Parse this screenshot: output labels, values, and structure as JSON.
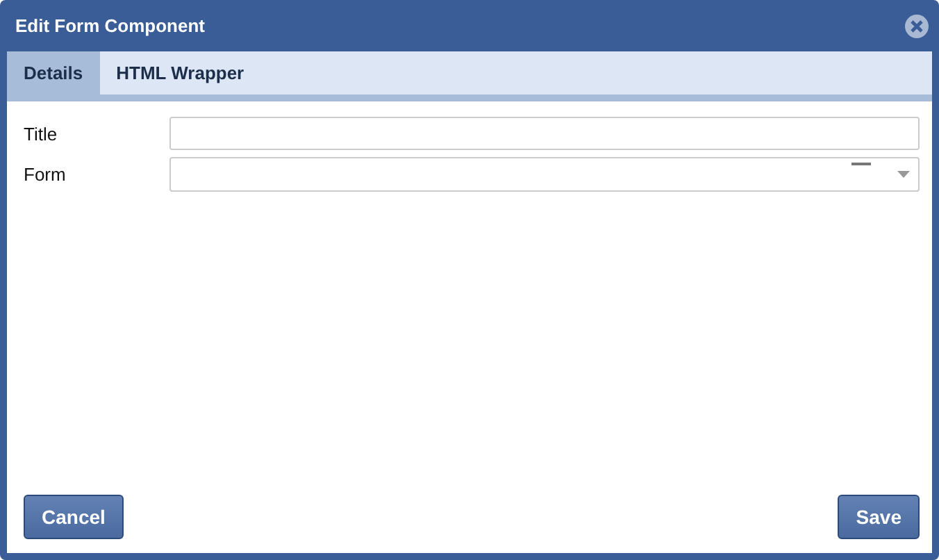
{
  "window": {
    "title": "Edit Form Component"
  },
  "tabs": [
    {
      "label": "Details",
      "selected": true
    },
    {
      "label": "HTML Wrapper",
      "selected": false
    }
  ],
  "fields": [
    {
      "label": "Title",
      "kind": "text"
    },
    {
      "label": "Form",
      "kind": "select"
    }
  ],
  "buttons": {
    "cancel": "Cancel",
    "save": "Save"
  }
}
